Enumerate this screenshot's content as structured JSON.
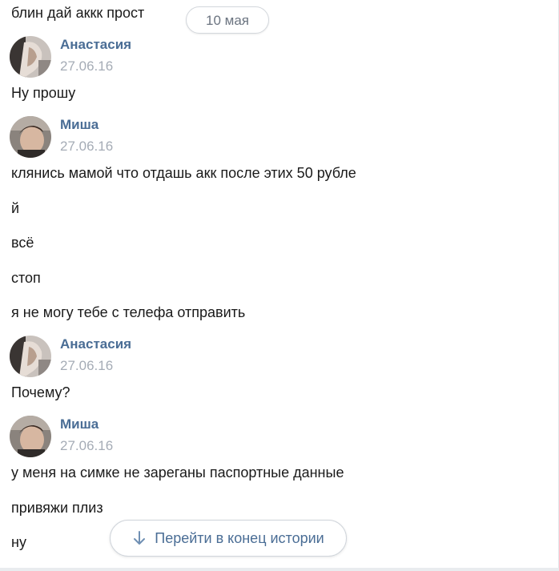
{
  "date_separator": "10 мая",
  "messages": [
    {
      "type": "text",
      "text": "блин дай аккк прост"
    },
    {
      "type": "author",
      "name": "Анастасия",
      "date": "27.06.16",
      "avatar": "anastasia-avatar"
    },
    {
      "type": "text",
      "text": "Ну прошу"
    },
    {
      "type": "author",
      "name": "Миша",
      "date": "27.06.16",
      "avatar": "misha-avatar"
    },
    {
      "type": "text",
      "text": "клянись мамой что отдашь акк после этих 50 рубле"
    },
    {
      "type": "text",
      "text": "й"
    },
    {
      "type": "text",
      "text": "всё"
    },
    {
      "type": "text",
      "text": "стоп"
    },
    {
      "type": "text",
      "text": "я не могу тебе с телефа отправить"
    },
    {
      "type": "author",
      "name": "Анастасия",
      "date": "27.06.16",
      "avatar": "anastasia-avatar"
    },
    {
      "type": "text",
      "text": "Почему?"
    },
    {
      "type": "author",
      "name": "Миша",
      "date": "27.06.16",
      "avatar": "misha-avatar"
    },
    {
      "type": "text",
      "text": "у меня на симке не зареганы паспортные данные"
    },
    {
      "type": "text",
      "text": "привяжи плиз"
    },
    {
      "type": "text",
      "text": "ну"
    }
  ],
  "jump_button": {
    "label": "Перейти в конец истории",
    "icon": "arrow-down-icon"
  },
  "colors": {
    "author_name": "#4a6d95",
    "date": "#a5acb6",
    "text": "#1a1a1a",
    "link": "#4a6d95"
  }
}
